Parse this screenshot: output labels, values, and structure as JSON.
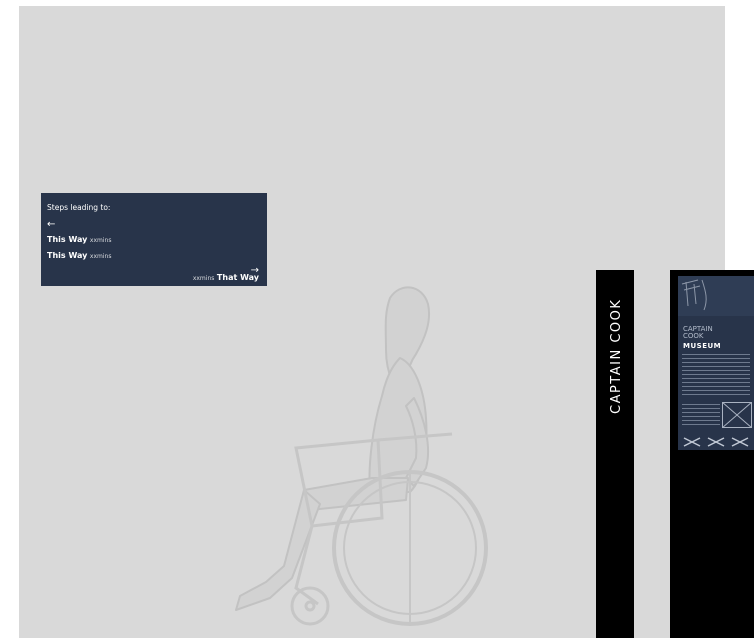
{
  "wayfinding_sign": {
    "title": "Steps leading to:",
    "left_arrow": "←",
    "right_arrow": "→",
    "rows": [
      {
        "destination": "This Way",
        "time": "xxmins"
      },
      {
        "destination": "This Way",
        "time": "xxmins"
      },
      {
        "destination": "That Way",
        "time": "xxmins"
      }
    ]
  },
  "pylon": {
    "text": "CAPTAIN COOK"
  },
  "museum_panel": {
    "title_line1": "CAPTAIN",
    "title_line2": "COOK",
    "title_line3": "MUSEUM"
  },
  "colors": {
    "background": "#d9d9d9",
    "sign_navy": "#28344a",
    "pylon_black": "#000000",
    "figure_stroke": "#c9c9c9"
  }
}
